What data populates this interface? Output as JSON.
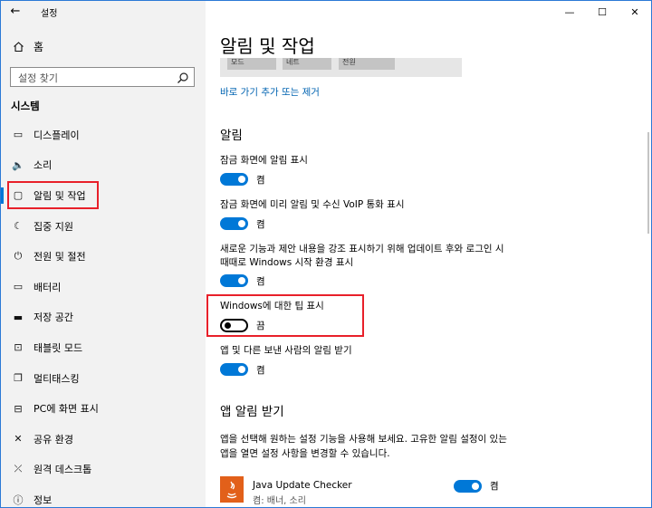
{
  "window": {
    "title": "설정",
    "controls": {
      "minimize": "—",
      "maximize": "☐",
      "close": "✕"
    }
  },
  "sidebar": {
    "back_glyph": "←",
    "home_label": "홈",
    "search_placeholder": "설정 찾기",
    "section_title": "시스템",
    "items": [
      {
        "label": "디스플레이",
        "icon": "display-icon",
        "glyph": "▭"
      },
      {
        "label": "소리",
        "icon": "speaker-icon",
        "glyph": "🔈"
      },
      {
        "label": "알림 및 작업",
        "icon": "notification-icon",
        "glyph": "▢",
        "active": true
      },
      {
        "label": "집중 지원",
        "icon": "moon-icon",
        "glyph": "☾"
      },
      {
        "label": "전원 및 절전",
        "icon": "power-icon",
        "glyph": "⏻"
      },
      {
        "label": "배터리",
        "icon": "battery-icon",
        "glyph": "▭"
      },
      {
        "label": "저장 공간",
        "icon": "storage-icon",
        "glyph": "▬"
      },
      {
        "label": "태블릿 모드",
        "icon": "tablet-icon",
        "glyph": "⊡"
      },
      {
        "label": "멀티태스킹",
        "icon": "multitask-icon",
        "glyph": "❐"
      },
      {
        "label": "PC에 화면 표시",
        "icon": "project-icon",
        "glyph": "⊟"
      },
      {
        "label": "공유 환경",
        "icon": "shared-icon",
        "glyph": "✕"
      },
      {
        "label": "원격 데스크톱",
        "icon": "remote-icon",
        "glyph": "⤫"
      },
      {
        "label": "정보",
        "icon": "info-icon",
        "glyph": "ⓘ"
      }
    ]
  },
  "main": {
    "page_title": "알림 및 작업",
    "quick_tiles": [
      "모드",
      "네트",
      "전원"
    ],
    "link_label": "바로 가기 추가 또는 제거",
    "notifications_head": "알림",
    "settings": [
      {
        "label": "잠금 화면에 알림 표시",
        "state": "켬",
        "on": true
      },
      {
        "label": "잠금 화면에 미리 알림 및 수신 VoIP 통화 표시",
        "state": "켬",
        "on": true
      },
      {
        "label": "새로운 기능과 제안 내용을 강조 표시하기 위해 업데이트 후와 로그인 시 때때로 Windows 시작 환경 표시",
        "state": "켬",
        "on": true
      },
      {
        "label": "Windows에 대한 팁 표시",
        "state": "끔",
        "on": false
      },
      {
        "label": "앱 및 다른 보낸 사람의 알림 받기",
        "state": "켬",
        "on": true
      }
    ],
    "app_notif_head": "앱 알림 받기",
    "app_notif_desc": "앱을 선택해 원하는 설정 기능을 사용해 보세요. 고유한 알림 설정이 있는 앱을 열면 설정 사항을 변경할 수 있습니다.",
    "apps": [
      {
        "name": "Java Update Checker",
        "sub": "켬: 배너, 소리",
        "state": "켬"
      }
    ]
  },
  "colors": {
    "accent": "#0078d7",
    "highlight": "#e8202a",
    "sidebar_bg": "#f2f2f2"
  }
}
